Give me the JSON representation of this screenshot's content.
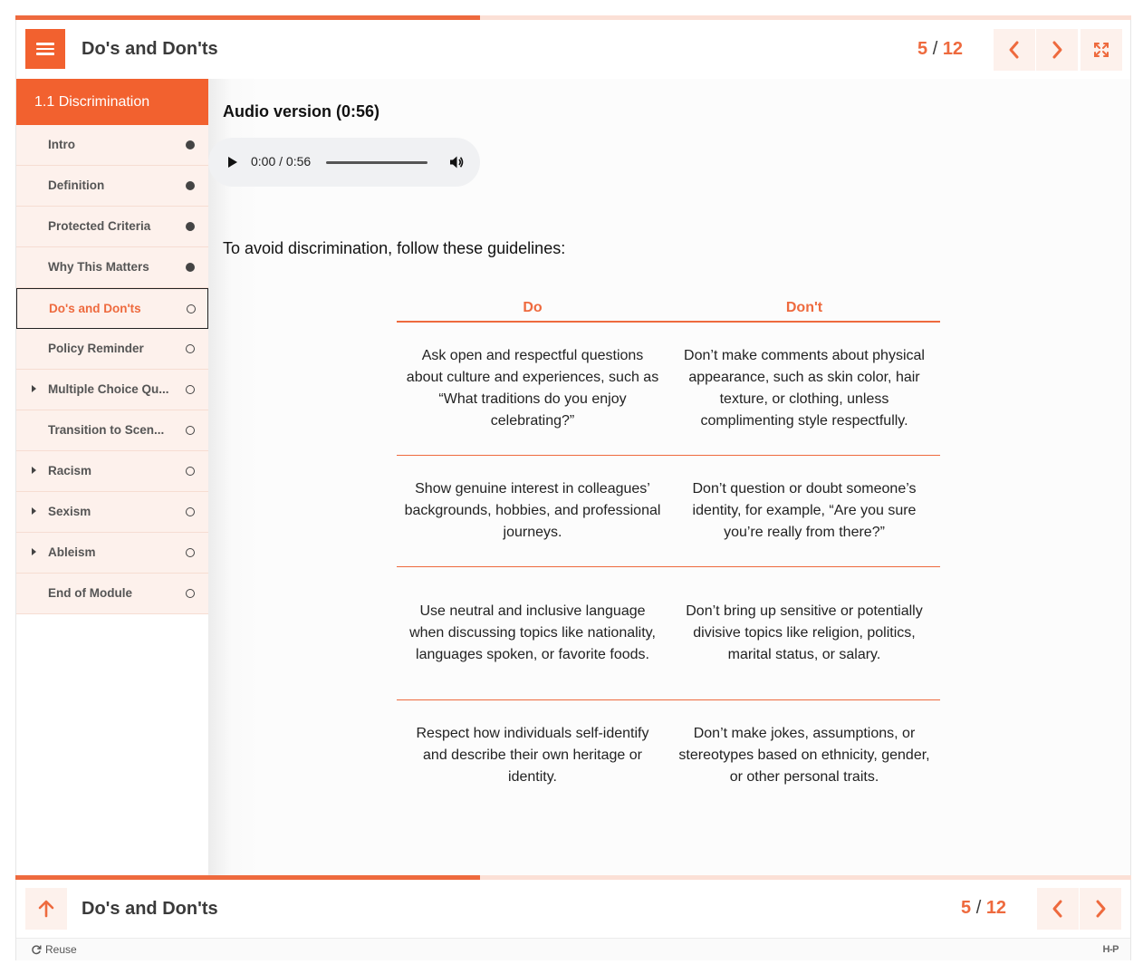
{
  "progress": {
    "fraction": 0.4167
  },
  "header": {
    "title": "Do's and Don'ts",
    "page_current": "5",
    "page_sep": "/",
    "page_total": "12"
  },
  "sidebar": {
    "chapter": "1.1 Discrimination",
    "items": [
      {
        "label": "Intro",
        "status": "done",
        "expandable": false
      },
      {
        "label": "Definition",
        "status": "done",
        "expandable": false
      },
      {
        "label": "Protected Criteria",
        "status": "done",
        "expandable": false
      },
      {
        "label": "Why This Matters",
        "status": "done",
        "expandable": false
      },
      {
        "label": "Do's and Don'ts",
        "status": "todo",
        "expandable": false,
        "active": true
      },
      {
        "label": "Policy Reminder",
        "status": "todo",
        "expandable": false
      },
      {
        "label": "Multiple Choice Qu...",
        "status": "todo",
        "expandable": true
      },
      {
        "label": "Transition to Scen...",
        "status": "todo",
        "expandable": false
      },
      {
        "label": "Racism",
        "status": "todo",
        "expandable": true
      },
      {
        "label": "Sexism",
        "status": "todo",
        "expandable": true
      },
      {
        "label": "Ableism",
        "status": "todo",
        "expandable": true
      },
      {
        "label": "End of Module",
        "status": "todo",
        "expandable": false
      }
    ]
  },
  "content": {
    "audio_title": "Audio version (0:56)",
    "audio_time": "0:00 / 0:56",
    "intro": "To avoid discrimination, follow these guidelines:",
    "table": {
      "headers": [
        "Do",
        "Don't"
      ],
      "rows": [
        [
          "Ask open and respectful questions about culture and experiences, such as “What traditions do you enjoy celebrating?”",
          "Don’t make comments about physical appearance, such as skin color, hair texture, or clothing, unless complimenting style respectfully."
        ],
        [
          "Show genuine interest in colleagues’ backgrounds, hobbies, and professional journeys.",
          "Don’t question or doubt someone’s identity, for example, “Are you sure you’re really from there?”"
        ],
        [
          "Use neutral and inclusive language when discussing topics like nationality, languages spoken, or favorite foods.",
          "Don’t bring up sensitive or potentially divisive topics like religion, politics, marital status, or salary."
        ],
        [
          "Respect how individuals self-identify and describe their own heritage or identity.",
          "Don’t make jokes, assumptions, or stereotypes based on ethnicity, gender, or other personal traits."
        ]
      ]
    }
  },
  "footer": {
    "title": "Do's and Don'ts",
    "page_current": "5",
    "page_sep": "/",
    "page_total": "12",
    "reuse_label": "Reuse",
    "brand": "H-P"
  },
  "colors": {
    "accent": "#f2612f",
    "accent_light": "#fdf1ec"
  }
}
